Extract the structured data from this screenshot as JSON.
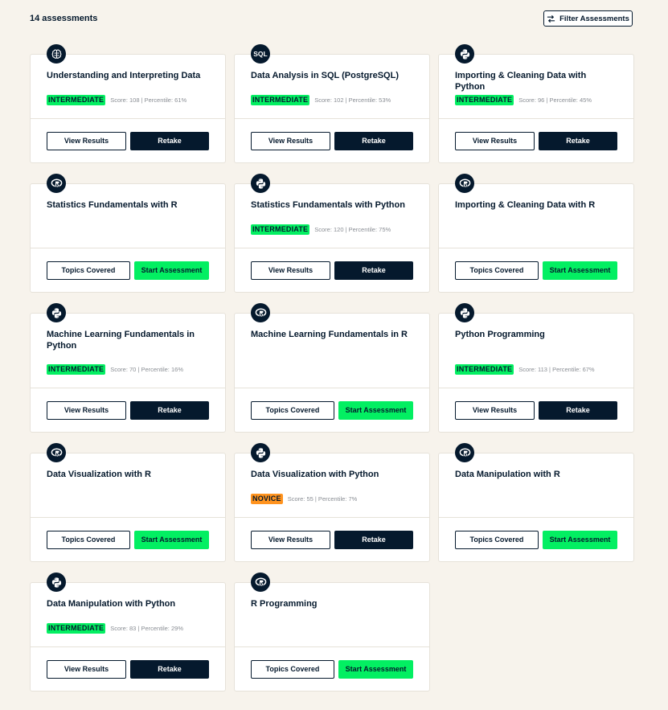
{
  "header": {
    "count_label": "14 assessments",
    "filter_label": "Filter Assessments"
  },
  "buttons": {
    "view_results": "View Results",
    "retake": "Retake",
    "topics_covered": "Topics Covered",
    "start_assessment": "Start Assessment"
  },
  "colors": {
    "background": "#f7f3ec",
    "navy": "#05192d",
    "green": "#03ef62",
    "orange": "#ff931e"
  },
  "cards": [
    {
      "title": "Understanding and Interpreting Data",
      "icon": "brain-icon",
      "level": "INTERMEDIATE",
      "score": "Score: 108 | Percentile: 61%",
      "state": "completed"
    },
    {
      "title": "Data Analysis in SQL (PostgreSQL)",
      "icon": "sql-icon",
      "icon_text": "SQL",
      "level": "INTERMEDIATE",
      "score": "Score: 102 | Percentile: 53%",
      "state": "completed"
    },
    {
      "title": "Importing & Cleaning Data with Python",
      "icon": "python-icon",
      "level": "INTERMEDIATE",
      "score": "Score: 96 | Percentile: 45%",
      "state": "completed"
    },
    {
      "title": "Statistics Fundamentals with R",
      "icon": "r-icon",
      "state": "new"
    },
    {
      "title": "Statistics Fundamentals with Python",
      "icon": "python-icon",
      "level": "INTERMEDIATE",
      "score": "Score: 120 | Percentile: 75%",
      "state": "completed"
    },
    {
      "title": "Importing & Cleaning Data with R",
      "icon": "r-icon",
      "state": "new"
    },
    {
      "title": "Machine Learning Fundamentals in Python",
      "icon": "python-icon",
      "level": "INTERMEDIATE",
      "score": "Score: 70 | Percentile: 16%",
      "state": "completed"
    },
    {
      "title": "Machine Learning Fundamentals in R",
      "icon": "r-icon",
      "state": "new"
    },
    {
      "title": "Python Programming",
      "icon": "python-icon",
      "level": "INTERMEDIATE",
      "score": "Score: 113 | Percentile: 67%",
      "state": "completed"
    },
    {
      "title": "Data Visualization with R",
      "icon": "r-icon",
      "state": "new"
    },
    {
      "title": "Data Visualization with Python",
      "icon": "python-icon",
      "level": "NOVICE",
      "score": "Score: 55 | Percentile: 7%",
      "state": "completed"
    },
    {
      "title": "Data Manipulation with R",
      "icon": "r-icon",
      "state": "new"
    },
    {
      "title": "Data Manipulation with Python",
      "icon": "python-icon",
      "level": "INTERMEDIATE",
      "score": "Score: 83 | Percentile: 29%",
      "state": "completed"
    },
    {
      "title": "R Programming",
      "icon": "r-icon",
      "state": "new"
    }
  ]
}
